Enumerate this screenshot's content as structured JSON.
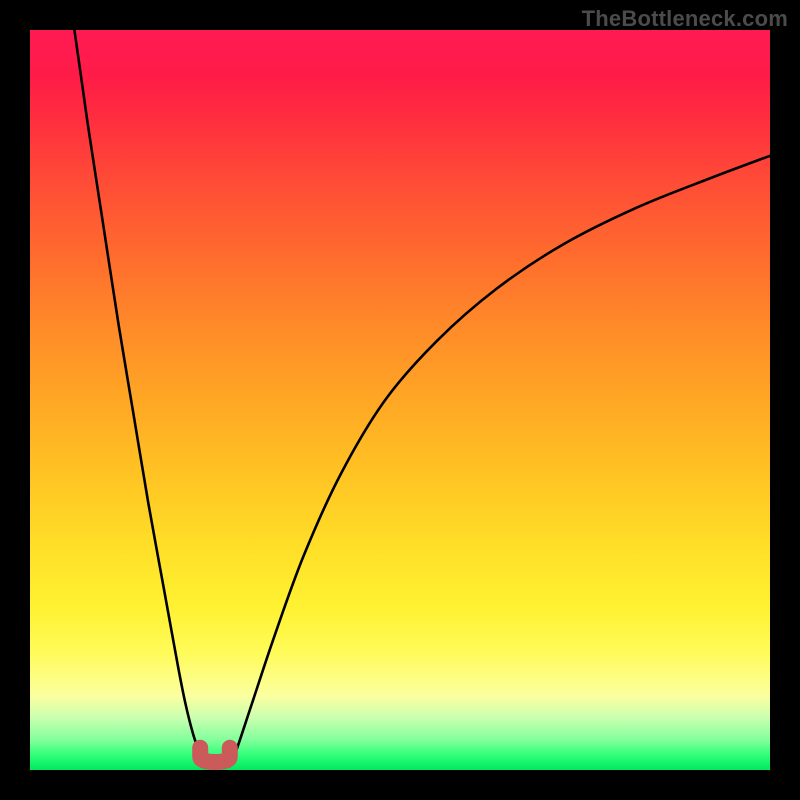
{
  "watermark": "TheBottleneck.com",
  "chart_data": {
    "type": "line",
    "title": "",
    "xlabel": "",
    "ylabel": "",
    "xlim": [
      0,
      100
    ],
    "ylim": [
      0,
      100
    ],
    "series": [
      {
        "name": "left-curve",
        "x": [
          6,
          7,
          8,
          10,
          12,
          14,
          16,
          18,
          20,
          21,
          22,
          23,
          23.5
        ],
        "values": [
          100,
          93,
          86,
          73,
          60,
          48,
          36,
          25,
          14,
          9,
          5,
          2,
          0.5
        ]
      },
      {
        "name": "right-curve",
        "x": [
          27,
          28,
          30,
          33,
          37,
          42,
          48,
          55,
          63,
          72,
          82,
          92,
          100
        ],
        "values": [
          0.5,
          3,
          9,
          18,
          29,
          40,
          50,
          58,
          65,
          71,
          76,
          80,
          83
        ]
      }
    ],
    "marker": {
      "name": "bottleneck-marker",
      "x_range": [
        23,
        27
      ],
      "y_range": [
        0,
        3
      ],
      "color": "#cb5a5a"
    },
    "gradient_stops": [
      {
        "pos": 0.0,
        "color": "#ff1b52"
      },
      {
        "pos": 0.5,
        "color": "#ffa724"
      },
      {
        "pos": 0.84,
        "color": "#fffb58"
      },
      {
        "pos": 0.96,
        "color": "#80ff9a"
      },
      {
        "pos": 1.0,
        "color": "#00e85f"
      }
    ]
  }
}
